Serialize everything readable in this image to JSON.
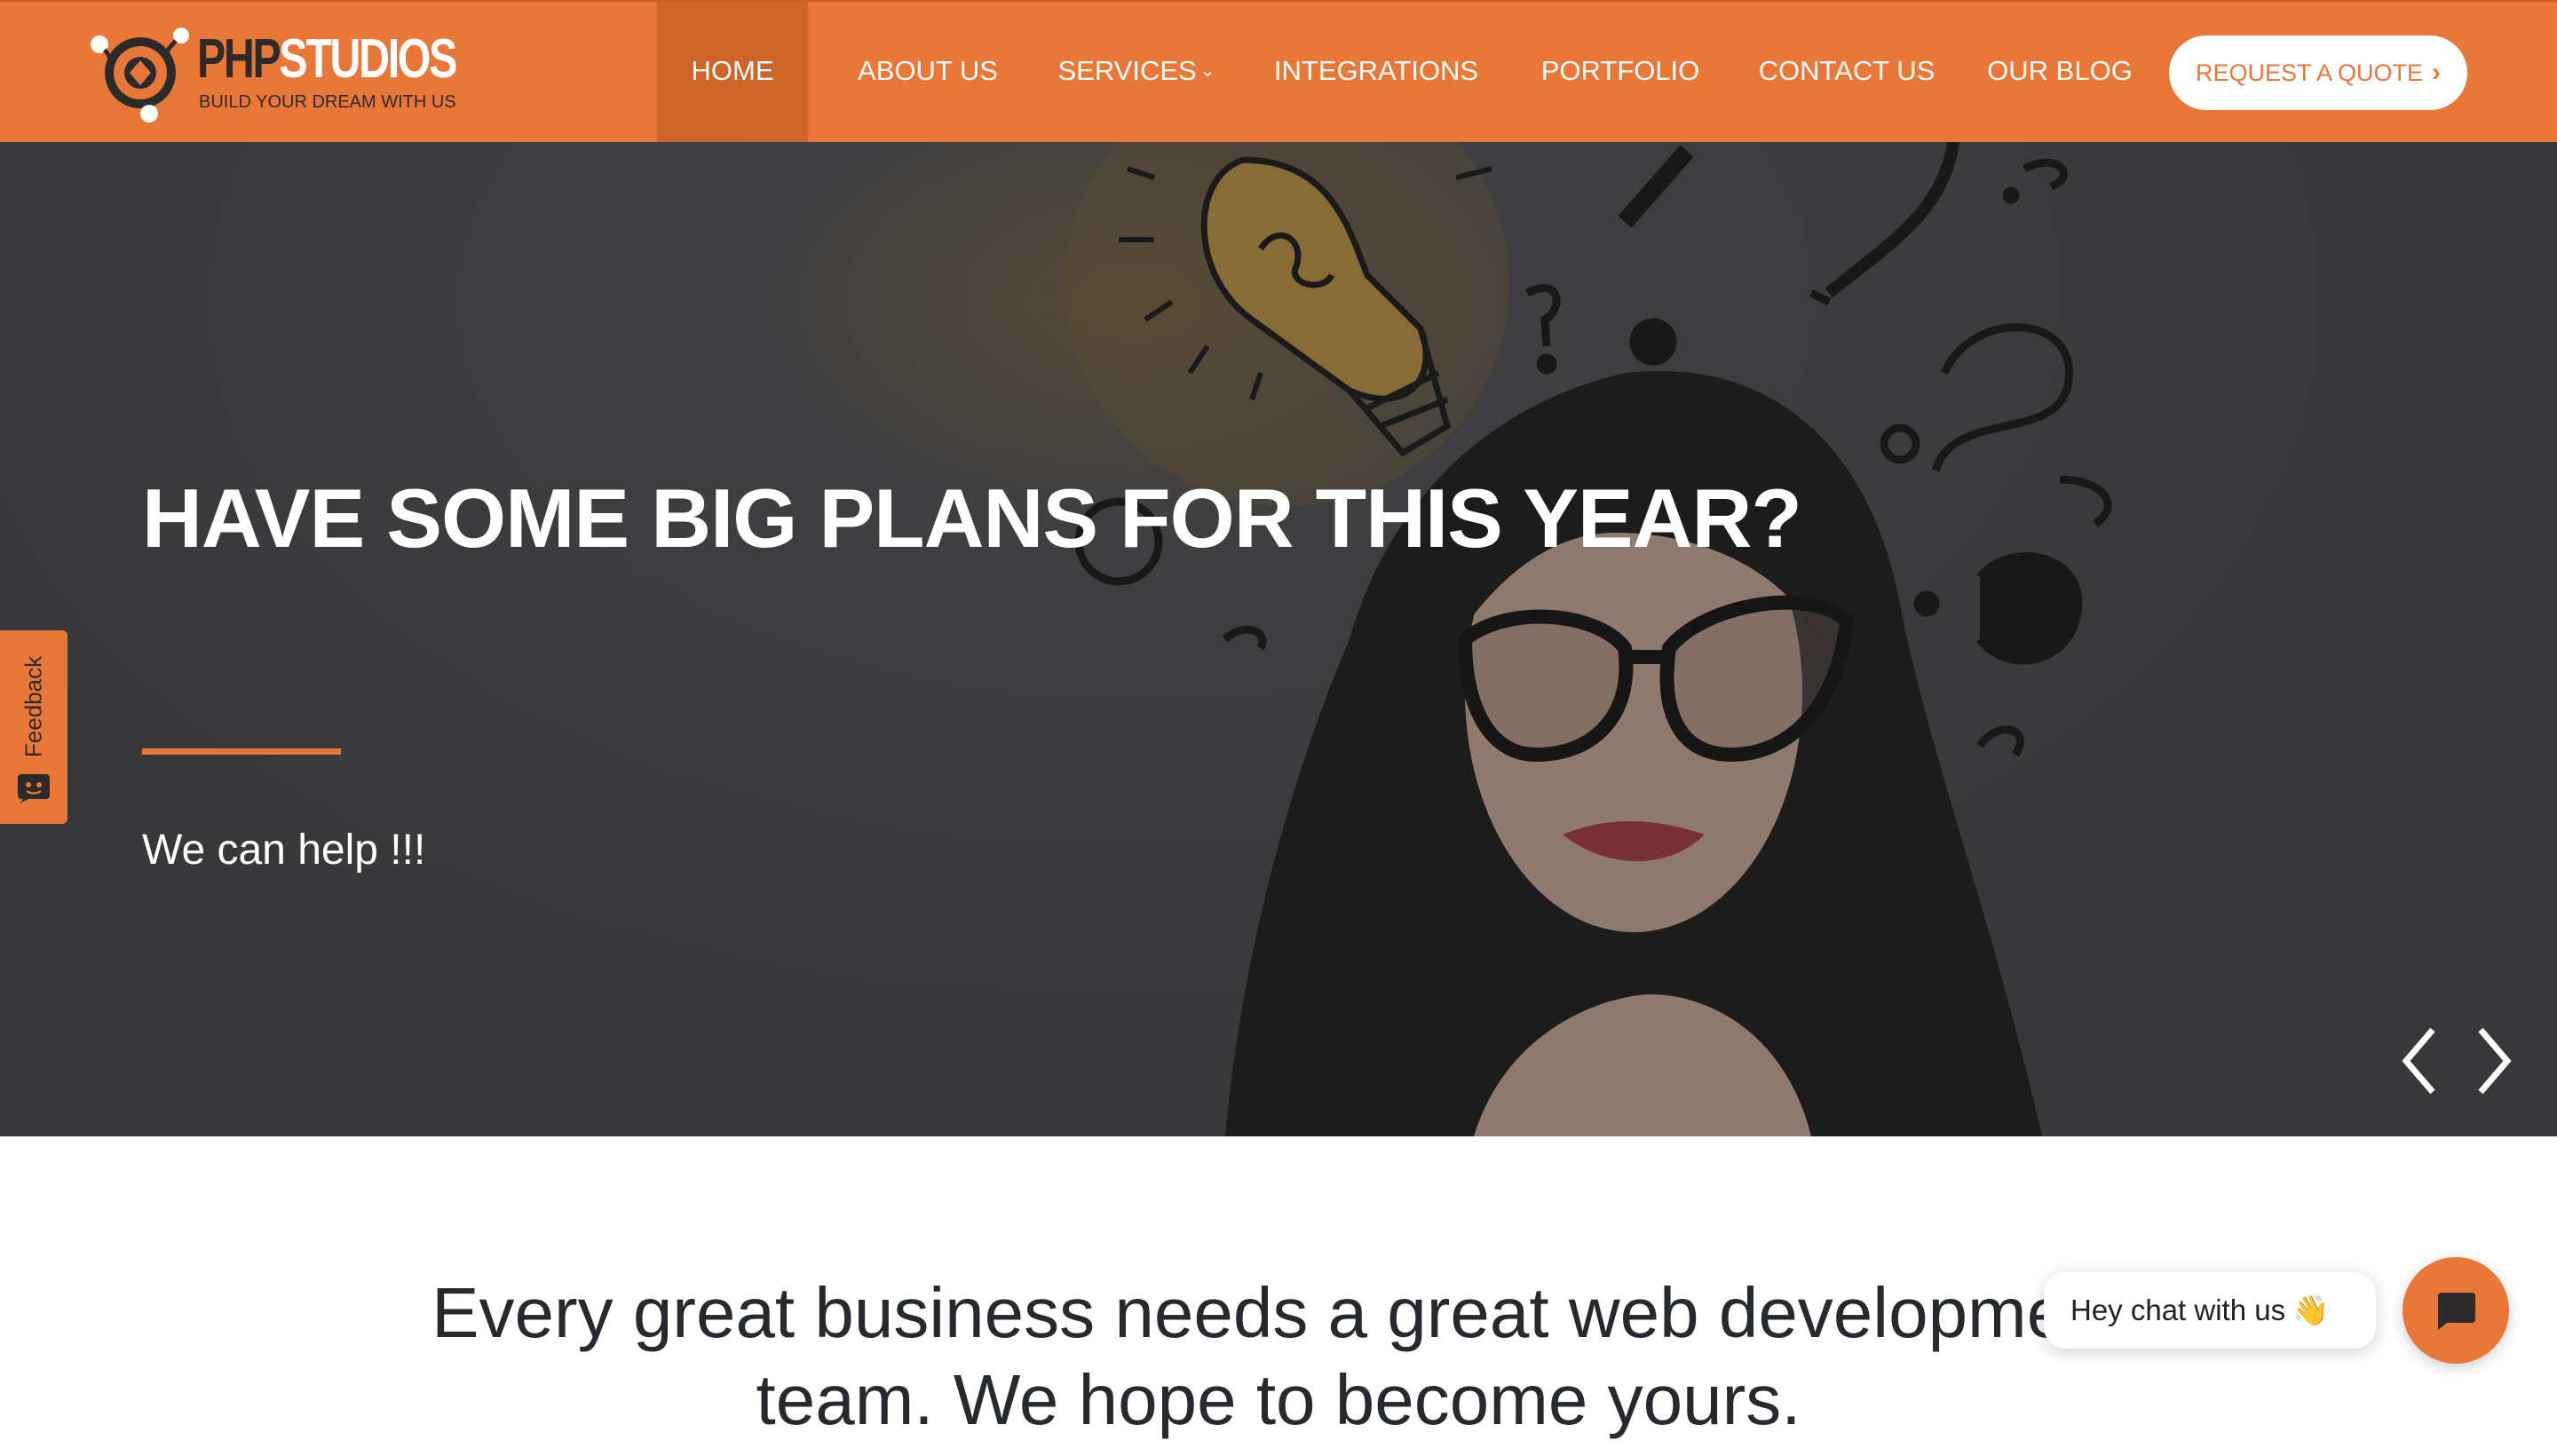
{
  "brand": {
    "name_part1": "PHP",
    "name_part2": "STUDIOS",
    "tagline": "BUILD YOUR DREAM WITH US"
  },
  "nav": {
    "items": [
      {
        "label": "HOME",
        "active": true
      },
      {
        "label": "ABOUT US",
        "active": false
      },
      {
        "label": "SERVICES",
        "active": false,
        "dropdown": true
      },
      {
        "label": "INTEGRATIONS",
        "active": false
      },
      {
        "label": "PORTFOLIO",
        "active": false
      },
      {
        "label": "CONTACT US",
        "active": false
      },
      {
        "label": "OUR BLOG",
        "active": false
      }
    ],
    "cta_label": "REQUEST A QUOTE"
  },
  "hero": {
    "title": "HAVE SOME BIG PLANS FOR THIS YEAR?",
    "subtitle": "We can help !!!",
    "prev_icon": "chevron-left-icon",
    "next_icon": "chevron-right-icon"
  },
  "feedback": {
    "label": "Feedback",
    "icon": "chat-face-icon"
  },
  "intro": {
    "line1": "Every great business needs a great web development",
    "line2": "team. We hope to become yours."
  },
  "chat": {
    "bubble_text": "Hey chat with us",
    "wave_emoji": "👋",
    "icon": "chat-icon"
  },
  "colors": {
    "brand_orange": "#e97737",
    "active_nav": "#cf6428",
    "hero_bg": "#454547",
    "text_dark": "#26292e"
  }
}
